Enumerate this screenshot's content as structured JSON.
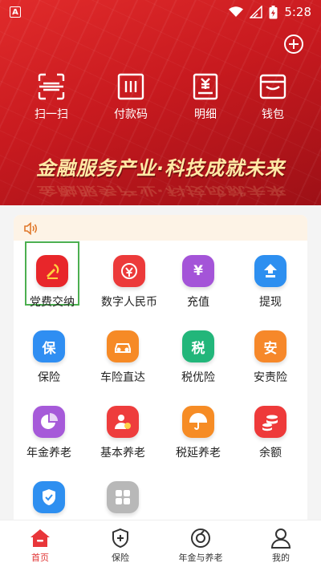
{
  "status_bar": {
    "time": "5:28"
  },
  "quick_actions": [
    {
      "label": "扫一扫",
      "icon": "scan-icon"
    },
    {
      "label": "付款码",
      "icon": "payment-code-icon"
    },
    {
      "label": "明细",
      "icon": "bill-details-icon"
    },
    {
      "label": "钱包",
      "icon": "wallet-icon"
    }
  ],
  "banner": {
    "slogan": "金融服务产业·科技成就未来"
  },
  "services": [
    {
      "label": "党费交纳",
      "icon": "party-emblem-icon",
      "color": "#e8262a"
    },
    {
      "label": "数字人民币",
      "icon": "digital-rmb-icon",
      "color": "#ec3a3a"
    },
    {
      "label": "充值",
      "icon": "recharge-icon",
      "color": "#a454d8",
      "glyph": "¥"
    },
    {
      "label": "提现",
      "icon": "withdraw-icon",
      "color": "#2d8ff0"
    },
    {
      "label": "保险",
      "icon": "insurance-icon",
      "color": "#2f8ef2",
      "glyph": "保"
    },
    {
      "label": "车险直达",
      "icon": "car-insurance-icon",
      "color": "#f68a26"
    },
    {
      "label": "税优险",
      "icon": "tax-insurance-icon",
      "color": "#22b67a",
      "glyph": "税"
    },
    {
      "label": "安责险",
      "icon": "safety-insurance-icon",
      "color": "#f6882a",
      "glyph": "安"
    },
    {
      "label": "年金养老",
      "icon": "annuity-pie-icon",
      "color": "#a65ad9"
    },
    {
      "label": "基本养老",
      "icon": "basic-pension-icon",
      "color": "#ee3d3d"
    },
    {
      "label": "税延养老",
      "icon": "umbrella-icon",
      "color": "#f68c25"
    },
    {
      "label": "余额",
      "icon": "balance-coins-icon",
      "color": "#ee3a3a"
    },
    {
      "label": "",
      "icon": "shield-check-icon",
      "color": "#2e8ff0"
    },
    {
      "label": "",
      "icon": "more-apps-icon",
      "color": "#b8b8b8"
    }
  ],
  "tabs": [
    {
      "label": "首页",
      "icon": "home-icon",
      "active": true
    },
    {
      "label": "保险",
      "icon": "shield-plus-icon",
      "active": false
    },
    {
      "label": "年金与养老",
      "icon": "annuity-icon",
      "active": false
    },
    {
      "label": "我的",
      "icon": "profile-icon",
      "active": false
    }
  ],
  "colors": {
    "brand_red": "#d5202a",
    "active_tab": "#e03333",
    "highlight_border": "#4caf50"
  }
}
